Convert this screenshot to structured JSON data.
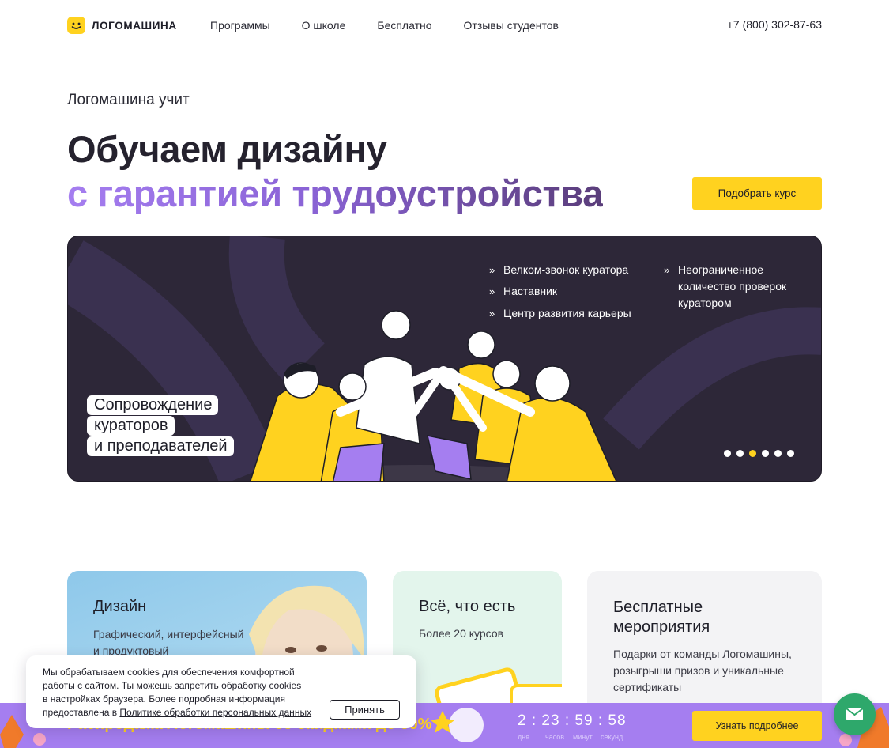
{
  "header": {
    "logo_text": "ЛОГОМАШИНА",
    "nav": [
      "Программы",
      "О школе",
      "Бесплатно",
      "Отзывы студентов"
    ],
    "phone": "+7 (800) 302-87-63"
  },
  "hero": {
    "eyebrow": "Логомашина учит",
    "title_line1": "Обучаем дизайну",
    "title_line2": "с гарантией трудоустройства",
    "cta_label": "Подобрать курс"
  },
  "banner": {
    "features_left": [
      "Велком-звонок куратора",
      "Наставник",
      "Центр развития карьеры"
    ],
    "features_right": [
      "Неограниченное",
      "количество проверок",
      "куратором"
    ],
    "caption": [
      "Сопровождение",
      "кураторов",
      "и преподавателей"
    ],
    "slides_count": 6,
    "active_slide": 3
  },
  "cards": [
    {
      "title": "Дизайн",
      "subtitle": [
        "Графический, интерфейсный",
        "и продуктовый"
      ]
    },
    {
      "title": "Всё, что есть",
      "subtitle": [
        "Более 20 курсов"
      ]
    },
    {
      "title": [
        "Бесплатные",
        "мероприятия"
      ],
      "subtitle": [
        "Подарки от команды Логомашины,",
        "розыгрыши призов и уникальные",
        "сертификаты"
      ]
    }
  ],
  "cookie": {
    "text_lines": [
      "Мы обрабатываем cookies для обеспечения комфортной",
      "работы с сайтом. Ты можешь запретить обработку cookies",
      "в настройках браузера. Более подробная информация"
    ],
    "text_last_prefix": "предоставлена в ",
    "link_text": "Политике обработки персональных данных",
    "accept_label": "Принять"
  },
  "promo": {
    "text": "Распродажа Логомашины со скидками до 50%",
    "timer": {
      "days": "2",
      "hours": "23",
      "minutes": "59",
      "seconds": "58"
    },
    "timer_labels": [
      "дня",
      "часов",
      "минут",
      "секунд"
    ],
    "cta_label": "Узнать подробнее"
  },
  "colors": {
    "accent_yellow": "#ffd21f",
    "accent_purple": "#a57ef0",
    "banner_bg": "#2d2738",
    "chat_green": "#2ea86b"
  },
  "icons": [
    "logo-smile-icon",
    "chevron-double-right-icon",
    "mail-icon"
  ]
}
